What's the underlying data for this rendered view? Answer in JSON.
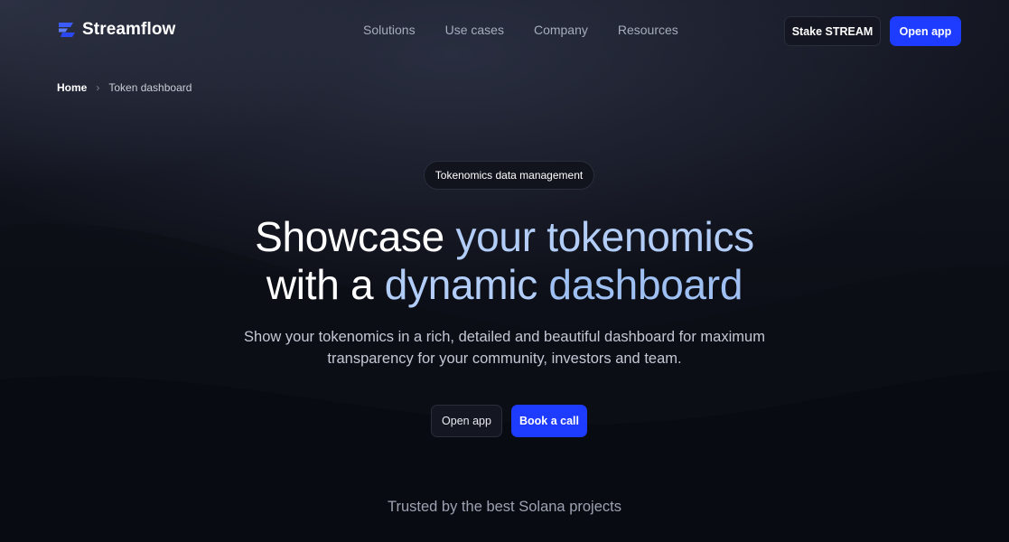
{
  "header": {
    "logo_text": "Streamflow",
    "nav": [
      "Solutions",
      "Use cases",
      "Company",
      "Resources"
    ],
    "stake_label": "Stake STREAM",
    "open_app_label": "Open app"
  },
  "breadcrumb": {
    "home": "Home",
    "separator": "›",
    "current": "Token dashboard"
  },
  "hero": {
    "pill": "Tokenomics data management",
    "headline": {
      "line1_a": "Showcase ",
      "line1_b": "your tokenomics",
      "line2_a": "with a ",
      "line2_b": "dynamic ",
      "line2_c": "dashboard"
    },
    "subtitle_line1": "Show your tokenomics in a rich, detailed and beautiful dashboard for maximum",
    "subtitle_line2": "transparency for your community, investors and team.",
    "cta_open": "Open app",
    "cta_book": "Book a call"
  },
  "trusted": "Trusted by the best Solana projects",
  "colors": {
    "accent": "#1d3cff",
    "background": "#0b0d14",
    "headline_highlight": "#b2cdf7"
  },
  "icons": {
    "logo": "streamflow-logo-icon",
    "breadcrumb_separator": "chevron-right-icon"
  }
}
